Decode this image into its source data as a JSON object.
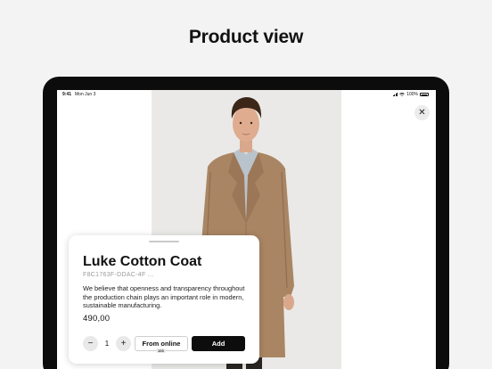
{
  "page": {
    "heading": "Product view"
  },
  "status_bar": {
    "time": "9:41",
    "date": "Mon Jun 3",
    "battery": "100%"
  },
  "product": {
    "name": "Luke Cotton Coat",
    "sku": "F8C1763F-DDAC-4F ...",
    "description": "We believe that openness and transparency throughout the production chain plays an important role in modern, sustainable manufacturing.",
    "price": "490,00",
    "quantity": "1"
  },
  "actions": {
    "from_online_label": "From online",
    "from_online_count": "105",
    "add_label": "Add",
    "decrement_symbol": "−",
    "increment_symbol": "+",
    "close_symbol": "✕"
  },
  "colors": {
    "coat": "#a98563",
    "shirt": "#b9c3cc",
    "background": "#f3f3f3",
    "button_dark": "#0d0d0d"
  }
}
